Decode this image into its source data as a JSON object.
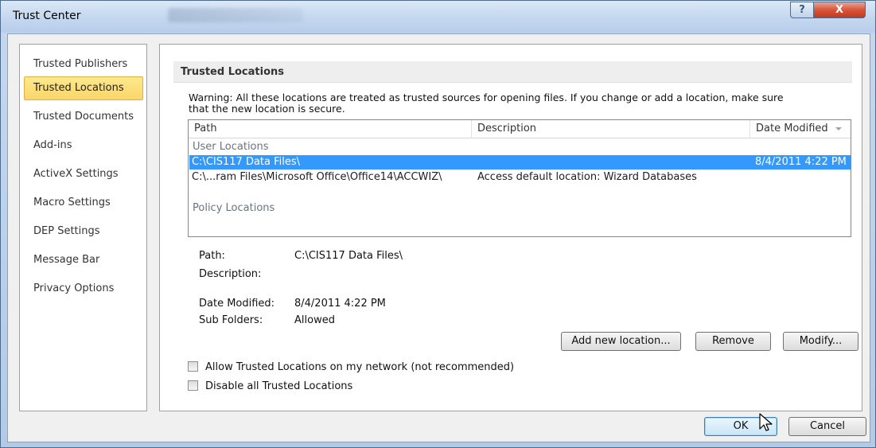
{
  "window": {
    "title": "Trust Center",
    "help_glyph": "?",
    "close_glyph": "X"
  },
  "sidebar": {
    "items": [
      {
        "label": "Trusted Publishers"
      },
      {
        "label": "Trusted Locations",
        "selected": true
      },
      {
        "label": "Trusted Documents"
      },
      {
        "label": "Add-ins"
      },
      {
        "label": "ActiveX Settings"
      },
      {
        "label": "Macro Settings"
      },
      {
        "label": "DEP Settings"
      },
      {
        "label": "Message Bar"
      },
      {
        "label": "Privacy Options"
      }
    ]
  },
  "main": {
    "section_title": "Trusted Locations",
    "warning_line1": "Warning: All these locations are treated as trusted sources for opening files.  If you change or add a location, make sure",
    "warning_line2": "that the new location is secure.",
    "list": {
      "columns": [
        "Path",
        "Description",
        "Date Modified"
      ],
      "user_locations_label": "User Locations",
      "policy_locations_label": "Policy Locations",
      "rows": [
        {
          "path": "C:\\CIS117 Data Files\\",
          "description": "",
          "date": "8/4/2011 4:22 PM",
          "selected": true
        },
        {
          "path": "C:\\...ram Files\\Microsoft Office\\Office14\\ACCWIZ\\",
          "description": "Access default location: Wizard Databases",
          "date": ""
        }
      ]
    },
    "details": {
      "path_label": "Path:",
      "path_value": "C:\\CIS117 Data Files\\",
      "description_label": "Description:",
      "description_value": "",
      "date_label": "Date Modified:",
      "date_value": "8/4/2011 4:22 PM",
      "subfolders_label": "Sub Folders:",
      "subfolders_value": "Allowed"
    },
    "buttons": {
      "add": "Add new location...",
      "remove": "Remove",
      "modify": "Modify..."
    },
    "checkboxes": {
      "allow_network": {
        "label": "Allow Trusted Locations on my network (not recommended)",
        "checked": false
      },
      "disable_all": {
        "label": "Disable all Trusted Locations",
        "checked": false
      }
    }
  },
  "footer": {
    "ok": "OK",
    "cancel": "Cancel"
  },
  "colors": {
    "selection": "#3399ff",
    "nav_selected": "#fbd56a"
  }
}
